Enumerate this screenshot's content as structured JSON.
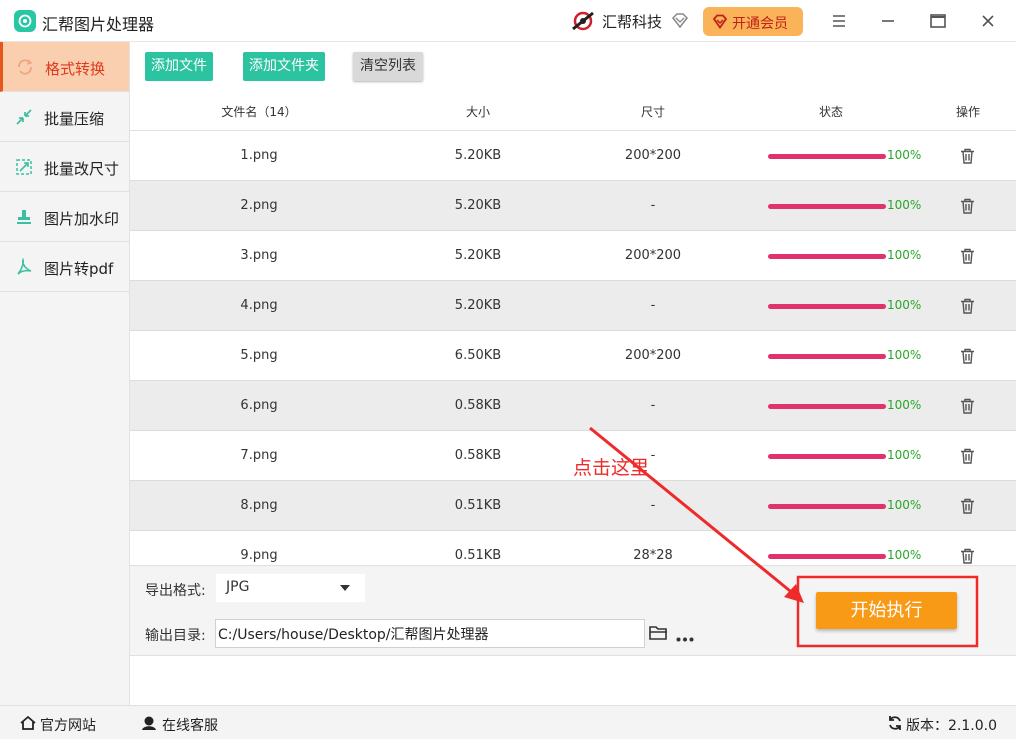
{
  "app": {
    "title": "汇帮图片处理器"
  },
  "brand": {
    "name": "汇帮科技"
  },
  "vip": {
    "label": "开通会员"
  },
  "sidebar": {
    "items": [
      {
        "label": "格式转换",
        "icon": "convert-icon",
        "active": true
      },
      {
        "label": "批量压缩",
        "icon": "compress-icon",
        "active": false
      },
      {
        "label": "批量改尺寸",
        "icon": "resize-icon",
        "active": false
      },
      {
        "label": "图片加水印",
        "icon": "watermark-icon",
        "active": false
      },
      {
        "label": "图片转pdf",
        "icon": "pdf-icon",
        "active": false
      }
    ]
  },
  "toolbar": {
    "add_file": "添加文件",
    "add_folder": "添加文件夹",
    "clear_list": "清空列表"
  },
  "table": {
    "headers": {
      "name": "文件名（14）",
      "size": "大小",
      "dims": "尺寸",
      "status": "状态",
      "action": "操作"
    },
    "rows": [
      {
        "name": "1.png",
        "size": "5.20KB",
        "dims": "200*200",
        "progress": "100%"
      },
      {
        "name": "2.png",
        "size": "5.20KB",
        "dims": "-",
        "progress": "100%"
      },
      {
        "name": "3.png",
        "size": "5.20KB",
        "dims": "200*200",
        "progress": "100%"
      },
      {
        "name": "4.png",
        "size": "5.20KB",
        "dims": "-",
        "progress": "100%"
      },
      {
        "name": "5.png",
        "size": "6.50KB",
        "dims": "200*200",
        "progress": "100%"
      },
      {
        "name": "6.png",
        "size": "0.58KB",
        "dims": "-",
        "progress": "100%"
      },
      {
        "name": "7.png",
        "size": "0.58KB",
        "dims": "-",
        "progress": "100%"
      },
      {
        "name": "8.png",
        "size": "0.51KB",
        "dims": "-",
        "progress": "100%"
      },
      {
        "name": "9.png",
        "size": "0.51KB",
        "dims": "28*28",
        "progress": "100%"
      }
    ]
  },
  "options": {
    "format_label": "导出格式:",
    "format_value": "JPG",
    "dir_label": "输出目录:",
    "dir_value": "C:/Users/house/Desktop/汇帮图片处理器"
  },
  "start_button": {
    "label": "开始执行"
  },
  "annotation": {
    "text": "点击这里"
  },
  "statusbar": {
    "website": "官方网站",
    "support": "在线客服",
    "version": "版本：2.1.0.0"
  },
  "colors": {
    "teal": "#2cc3a0",
    "active_bg": "#f9cfb0",
    "active_text": "#e03a1e",
    "progress": "#e0336c",
    "percent": "#2aa52a",
    "start": "#f99a16",
    "annotation": "#ee2a2a",
    "vip": "#fbb35a"
  }
}
